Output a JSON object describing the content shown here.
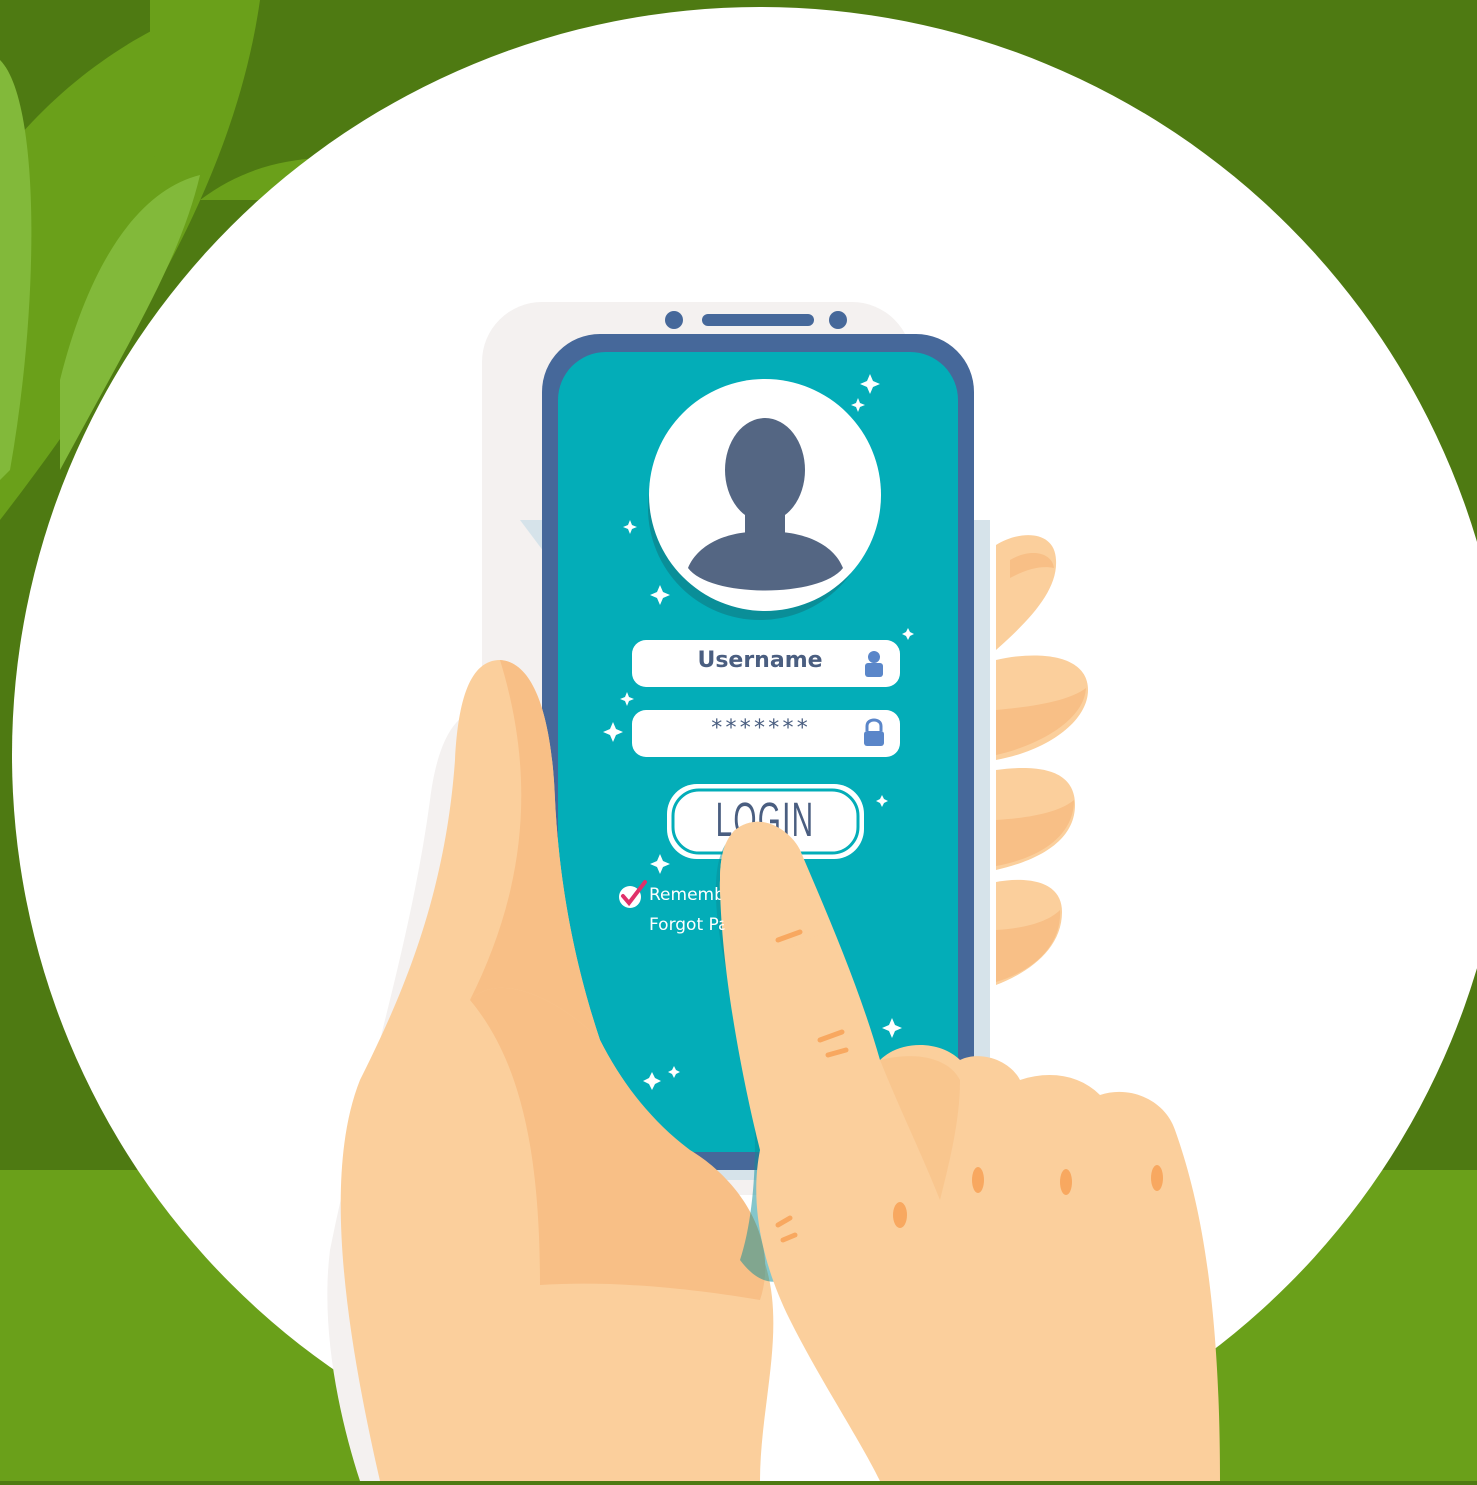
{
  "login_form": {
    "username_text": "Username",
    "password_text": "*******",
    "login_label": "LOGIN",
    "remember_text": "Rememb",
    "forgot_text": "Forgot Pa",
    "remember_checked": true
  },
  "icons": {
    "avatar": "user-silhouette-icon",
    "username_field": "user-icon",
    "password_field": "lock-icon",
    "remember_check": "checkmark-icon",
    "decor": "sparkle-icon"
  },
  "colors": {
    "background": "#4e7a12",
    "grass": "#6aa01a",
    "leaf": "#82b93a",
    "circle": "#ffffff",
    "phone_frame": "#46689a",
    "screen": "#03adb8",
    "avatar_figure": "#546683",
    "field": "#ffffff",
    "field_text": "#4a5e80",
    "field_icon": "#5a86c9",
    "check": "#e0306a",
    "skin": "#fbcf9c",
    "skin_shade": "#f8bf86"
  }
}
